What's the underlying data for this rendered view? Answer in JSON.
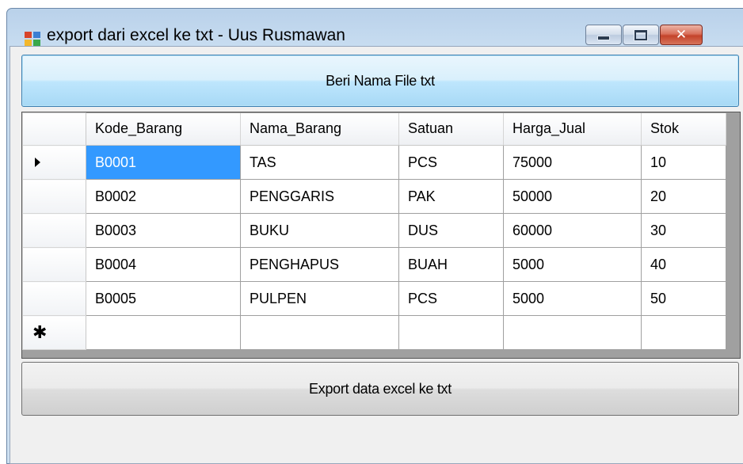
{
  "window": {
    "title": "export dari excel ke txt - Uus Rusmawan",
    "close_glyph": "✕"
  },
  "buttons": {
    "name_file": "Beri Nama File txt",
    "export": "Export data excel ke txt"
  },
  "grid": {
    "columns": [
      "Kode_Barang",
      "Nama_Barang",
      "Satuan",
      "Harga_Jual",
      "Stok"
    ],
    "rows": [
      [
        "B0001",
        "TAS",
        "PCS",
        "75000",
        "10"
      ],
      [
        "B0002",
        "PENGGARIS",
        "PAK",
        "50000",
        "20"
      ],
      [
        "B0003",
        "BUKU",
        "DUS",
        "60000",
        "30"
      ],
      [
        "B0004",
        "PENGHAPUS",
        "BUAH",
        "5000",
        "40"
      ],
      [
        "B0005",
        "PULPEN",
        "PCS",
        "5000",
        "50"
      ]
    ],
    "current_row_marker": "▶",
    "new_row_marker": "✱",
    "selected_cell": "B0001"
  },
  "colors": {
    "selection": "#3399ff",
    "title_bar": "#c7dcf0"
  },
  "icons": [
    "app-icon",
    "minimize-icon",
    "maximize-icon",
    "close-icon",
    "current-row-arrow-icon",
    "new-row-icon"
  ]
}
